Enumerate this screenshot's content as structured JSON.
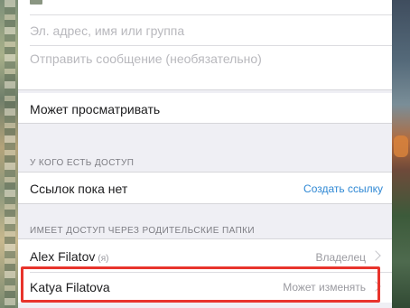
{
  "share": {
    "email_placeholder": "Эл. адрес, имя или группа",
    "message_placeholder": "Отправить сообщение (необязательно)",
    "permission_label": "Может просматривать"
  },
  "access": {
    "header": "У КОГО ЕСТЬ ДОСТУП",
    "no_links": "Ссылок пока нет",
    "create_link": "Создать ссылку"
  },
  "parent": {
    "header": "ИМЕЕТ ДОСТУП ЧЕРЕЗ РОДИТЕЛЬСКИЕ ПАПКИ",
    "members": [
      {
        "name": "Alex Filatov",
        "tag": "(я)",
        "role": "Владелец"
      },
      {
        "name": "Katya Filatova",
        "tag": "",
        "role": "Может изменять"
      }
    ]
  },
  "colors": {
    "link": "#2f88d4",
    "highlight": "#e8342c"
  }
}
